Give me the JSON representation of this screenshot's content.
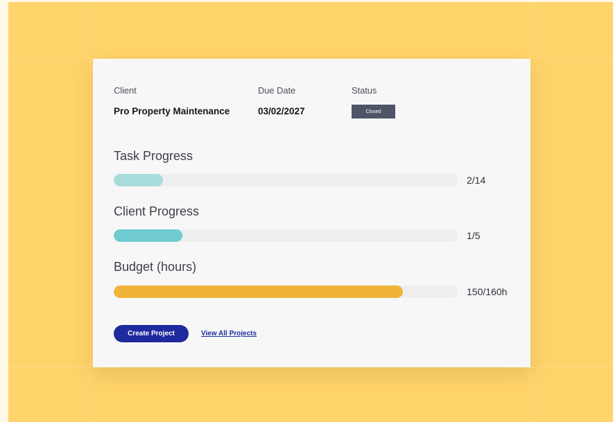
{
  "details": {
    "client_label": "Client",
    "client_value": "Pro Property Maintenance",
    "due_date_label": "Due Date",
    "due_date_value": "03/02/2027",
    "status_label": "Status",
    "status_value": "Closed",
    "status_color": "#4d5566"
  },
  "progress": [
    {
      "title": "Task Progress",
      "count": "2/14",
      "fraction": 0.1429,
      "color": "#a8dcdb"
    },
    {
      "title": "Client Progress",
      "count": "1/5",
      "fraction": 0.2,
      "color": "#6fcbd1"
    },
    {
      "title": "Budget (hours)",
      "count": "150/160h",
      "fraction": 0.84,
      "color": "#f0b43a"
    }
  ],
  "actions": {
    "create_label": "Create Project",
    "view_all_label": "View All Projects",
    "primary_color": "#1f2a9e"
  },
  "colors": {
    "background": "#ffd46b",
    "card": "#f7f7f8",
    "track": "#eeeeef"
  }
}
